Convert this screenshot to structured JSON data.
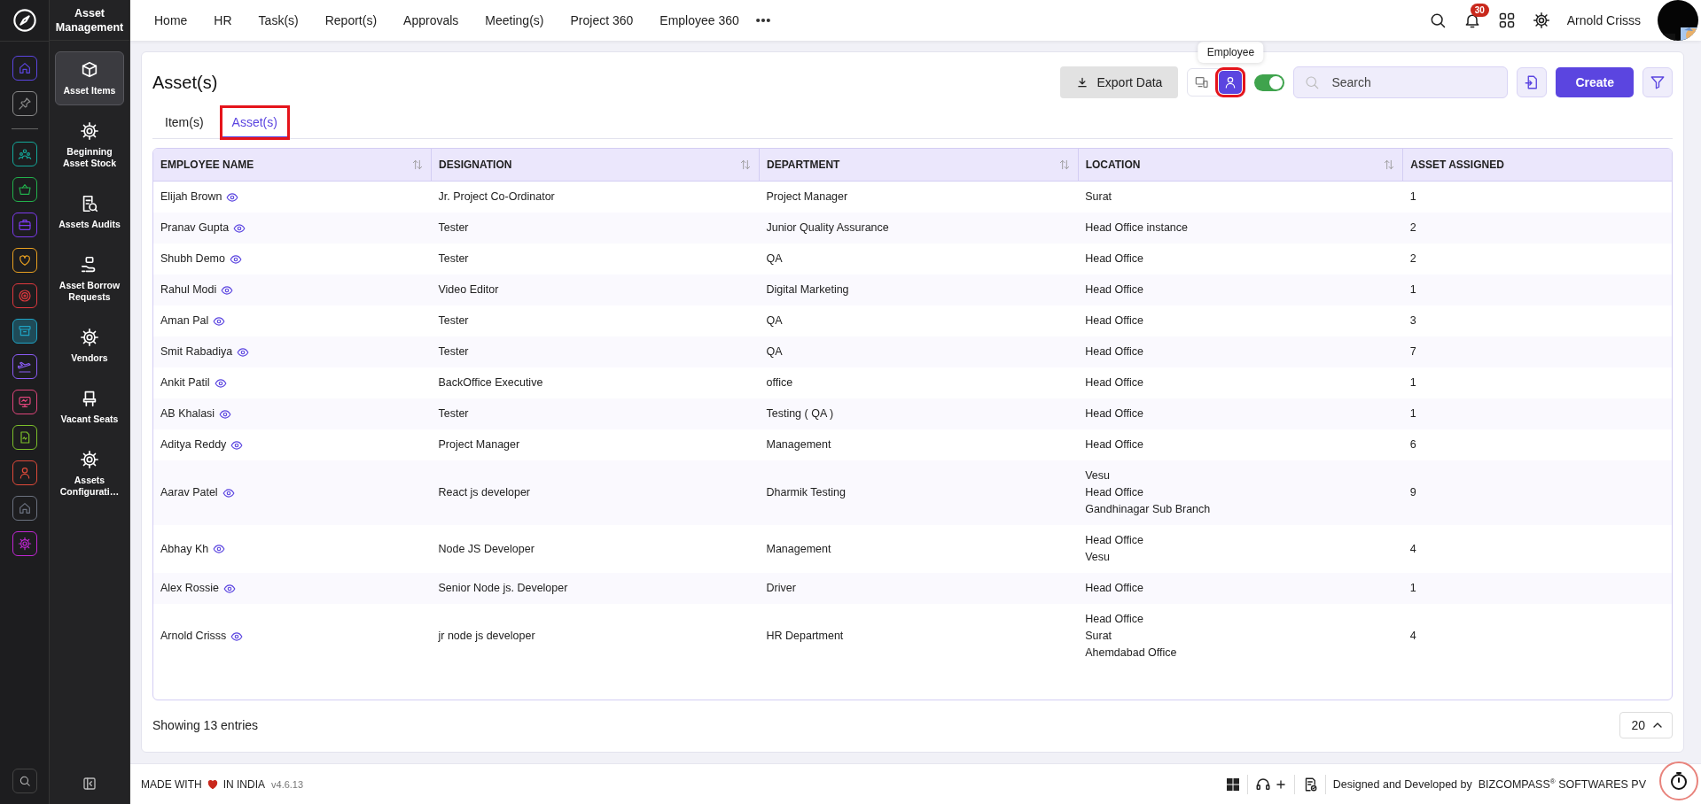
{
  "rail": {
    "items": [
      {
        "color": "#5b45e0",
        "selected": false
      },
      {
        "color": "#8a8a8a",
        "selected": false
      },
      {
        "color": "#14a89a",
        "selected": false
      },
      {
        "color": "#22b14c",
        "selected": false
      },
      {
        "color": "#7c3aed",
        "selected": false
      },
      {
        "color": "#e9a020",
        "selected": false
      },
      {
        "color": "#e0393e",
        "selected": false
      },
      {
        "color": "#1fa3c4",
        "selected": true
      },
      {
        "color": "#8b5cf6",
        "selected": false
      },
      {
        "color": "#e0457b",
        "selected": false
      },
      {
        "color": "#7cbf2a",
        "selected": false
      },
      {
        "color": "#e04a3a",
        "selected": false
      },
      {
        "color": "#6b7280",
        "selected": false
      },
      {
        "color": "#c026d3",
        "selected": false
      }
    ]
  },
  "sidebar": {
    "title": "Asset Management",
    "items": [
      {
        "label": "Asset Items",
        "selected": true
      },
      {
        "label": "Beginning Asset Stock",
        "selected": false
      },
      {
        "label": "Assets Audits",
        "selected": false
      },
      {
        "label": "Asset Borrow Requests",
        "selected": false
      },
      {
        "label": "Vendors",
        "selected": false
      },
      {
        "label": "Vacant Seats",
        "selected": false
      },
      {
        "label": "Assets Configurati…",
        "selected": false
      }
    ]
  },
  "topbar": {
    "nav": [
      "Home",
      "HR",
      "Task(s)",
      "Report(s)",
      "Approvals",
      "Meeting(s)",
      "Project 360",
      "Employee 360"
    ],
    "notifications": "30",
    "user": "Arnold Crisss"
  },
  "page": {
    "title": "Asset(s)",
    "export_button": "Export Data",
    "view_buttons": [
      {
        "selected": false,
        "highlighted": false
      },
      {
        "selected": true,
        "highlighted": true
      }
    ],
    "tooltip": "Employee",
    "toggle": {
      "on": true
    },
    "search": {
      "placeholder": "Search"
    },
    "create_button": "Create",
    "tabs": [
      {
        "label": "Item(s)",
        "selected": false,
        "highlighted": false
      },
      {
        "label": "Asset(s)",
        "selected": true,
        "highlighted": true
      }
    ]
  },
  "table": {
    "columns": [
      {
        "label": "EMPLOYEE NAME",
        "sortable": true
      },
      {
        "label": "DESIGNATION",
        "sortable": true
      },
      {
        "label": "DEPARTMENT",
        "sortable": true
      },
      {
        "label": "LOCATION",
        "sortable": true
      },
      {
        "label": "ASSET ASSIGNED",
        "sortable": false
      }
    ],
    "rows": [
      {
        "name": "Elijah Brown",
        "designation": "Jr. Project Co-Ordinator",
        "department": "Project Manager",
        "locations": [
          "Surat"
        ],
        "assets": "1"
      },
      {
        "name": "Pranav Gupta",
        "designation": "Tester",
        "department": "Junior Quality Assurance",
        "locations": [
          "Head Office instance"
        ],
        "assets": "2"
      },
      {
        "name": "Shubh Demo",
        "designation": "Tester",
        "department": "QA",
        "locations": [
          "Head Office"
        ],
        "assets": "2"
      },
      {
        "name": "Rahul Modi",
        "designation": "Video Editor",
        "department": "Digital Marketing",
        "locations": [
          "Head Office"
        ],
        "assets": "1"
      },
      {
        "name": "Aman Pal",
        "designation": "Tester",
        "department": "QA",
        "locations": [
          "Head Office"
        ],
        "assets": "3"
      },
      {
        "name": "Smit Rabadiya",
        "designation": "Tester",
        "department": "QA",
        "locations": [
          "Head Office"
        ],
        "assets": "7"
      },
      {
        "name": "Ankit Patil",
        "designation": "BackOffice Executive",
        "department": "office",
        "locations": [
          "Head Office"
        ],
        "assets": "1"
      },
      {
        "name": "AB Khalasi",
        "designation": "Tester",
        "department": "Testing ( QA )",
        "locations": [
          "Head Office"
        ],
        "assets": "1"
      },
      {
        "name": "Aditya Reddy",
        "designation": "Project Manager",
        "department": "Management",
        "locations": [
          "Head Office"
        ],
        "assets": "6"
      },
      {
        "name": "Aarav Patel",
        "designation": "React js developer",
        "department": "Dharmik Testing",
        "locations": [
          "Vesu",
          "Head Office",
          "Gandhinagar Sub Branch"
        ],
        "assets": "9"
      },
      {
        "name": "Abhay Kh",
        "designation": "Node JS Developer",
        "department": "Management",
        "locations": [
          "Head Office",
          "Vesu"
        ],
        "assets": "4"
      },
      {
        "name": "Alex Rossie",
        "designation": "Senior Node js. Developer",
        "department": "Driver",
        "locations": [
          "Head Office"
        ],
        "assets": "1"
      },
      {
        "name": "Arnold Crisss",
        "designation": "jr node js developer",
        "department": "HR Department",
        "locations": [
          "Head Office",
          "Surat",
          "Ahemdabad Office"
        ],
        "assets": "4"
      }
    ]
  },
  "pagination": {
    "summary": "Showing 13 entries",
    "page_size": "20"
  },
  "footer": {
    "made_with": "MADE WITH",
    "in_india": "IN INDIA",
    "version": "v4.6.13",
    "credit": "Designed and Developed by",
    "company": "BIZCOMPASS$^{®}$ SOFTWARES PV"
  }
}
